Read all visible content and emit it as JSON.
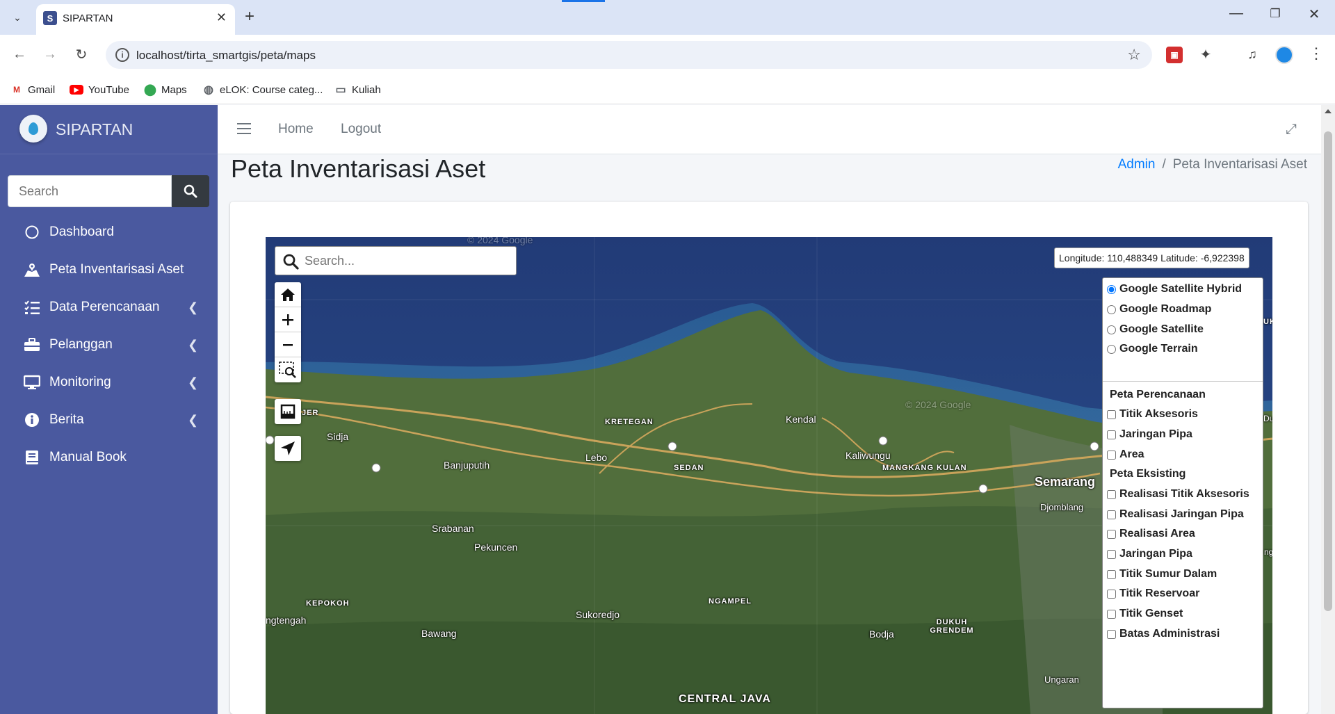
{
  "browser": {
    "tab_title": "SIPARTAN",
    "tab_favicon": "S",
    "url": "localhost/tirta_smartgis/peta/maps",
    "bookmarks": [
      {
        "label": "Gmail",
        "icon": "gmail-icon"
      },
      {
        "label": "YouTube",
        "icon": "youtube-icon"
      },
      {
        "label": "Maps",
        "icon": "maps-icon"
      },
      {
        "label": "eLOK: Course categ...",
        "icon": "elok-icon"
      },
      {
        "label": "Kuliah",
        "icon": "folder-icon"
      }
    ]
  },
  "sidebar": {
    "brand": "SIPARTAN",
    "search_placeholder": "Search",
    "items": [
      {
        "label": "Dashboard",
        "icon": "circle-icon",
        "has_submenu": false
      },
      {
        "label": "Peta Inventarisasi Aset",
        "icon": "map-marked-icon",
        "has_submenu": false
      },
      {
        "label": "Data Perencanaan",
        "icon": "list-check-icon",
        "has_submenu": true
      },
      {
        "label": "Pelanggan",
        "icon": "toolbox-icon",
        "has_submenu": true
      },
      {
        "label": "Monitoring",
        "icon": "desktop-icon",
        "has_submenu": true
      },
      {
        "label": "Berita",
        "icon": "info-circle-icon",
        "has_submenu": true
      },
      {
        "label": "Manual Book",
        "icon": "book-icon",
        "has_submenu": false
      }
    ]
  },
  "topnav": {
    "links": [
      "Home",
      "Logout"
    ]
  },
  "page": {
    "title": "Peta Inventarisasi Aset",
    "breadcrumb": [
      "Admin",
      "Peta Inventarisasi Aset"
    ]
  },
  "map": {
    "search_placeholder": "Search...",
    "coordinates": "Longitude: 110,488349 Latitude: -6,922398",
    "base_layers": [
      {
        "label": "Google Satellite Hybrid",
        "selected": true
      },
      {
        "label": "Google Roadmap",
        "selected": false
      },
      {
        "label": "Google Satellite",
        "selected": false
      },
      {
        "label": "Google Terrain",
        "selected": false
      }
    ],
    "overlay_groups": [
      {
        "title": "Peta Perencanaan",
        "layers": [
          "Titik Aksesoris",
          "Jaringan Pipa",
          "Area"
        ]
      },
      {
        "title": "Peta Eksisting",
        "layers": [
          "Realisasi Titik Aksesoris",
          "Realisasi Jaringan Pipa",
          "Realisasi Area",
          "Jaringan Pipa",
          "Titik Sumur Dalam",
          "Titik Reservoar",
          "Titik Genset",
          "Batas Administrasi"
        ]
      }
    ],
    "places": [
      "JER",
      "Sidja",
      "Banjuputih",
      "KRETEGAN",
      "Lebo",
      "SEDAN",
      "Kendal",
      "Kaliwungu",
      "MANGKANG KULAN",
      "Semarang",
      "Djomblang",
      "Srabanan",
      "Pekuncen",
      "KEPOKOH",
      "ngtengah",
      "Bawang",
      "Sukoredjo",
      "NGAMPEL",
      "DUKUH GRENDEM",
      "Bodja",
      "Ungaran",
      "CENTRAL JAVA",
      "UK",
      "Duk",
      "ng"
    ],
    "watermarks": [
      "© 2024 Google",
      "© 2024 Google"
    ]
  }
}
